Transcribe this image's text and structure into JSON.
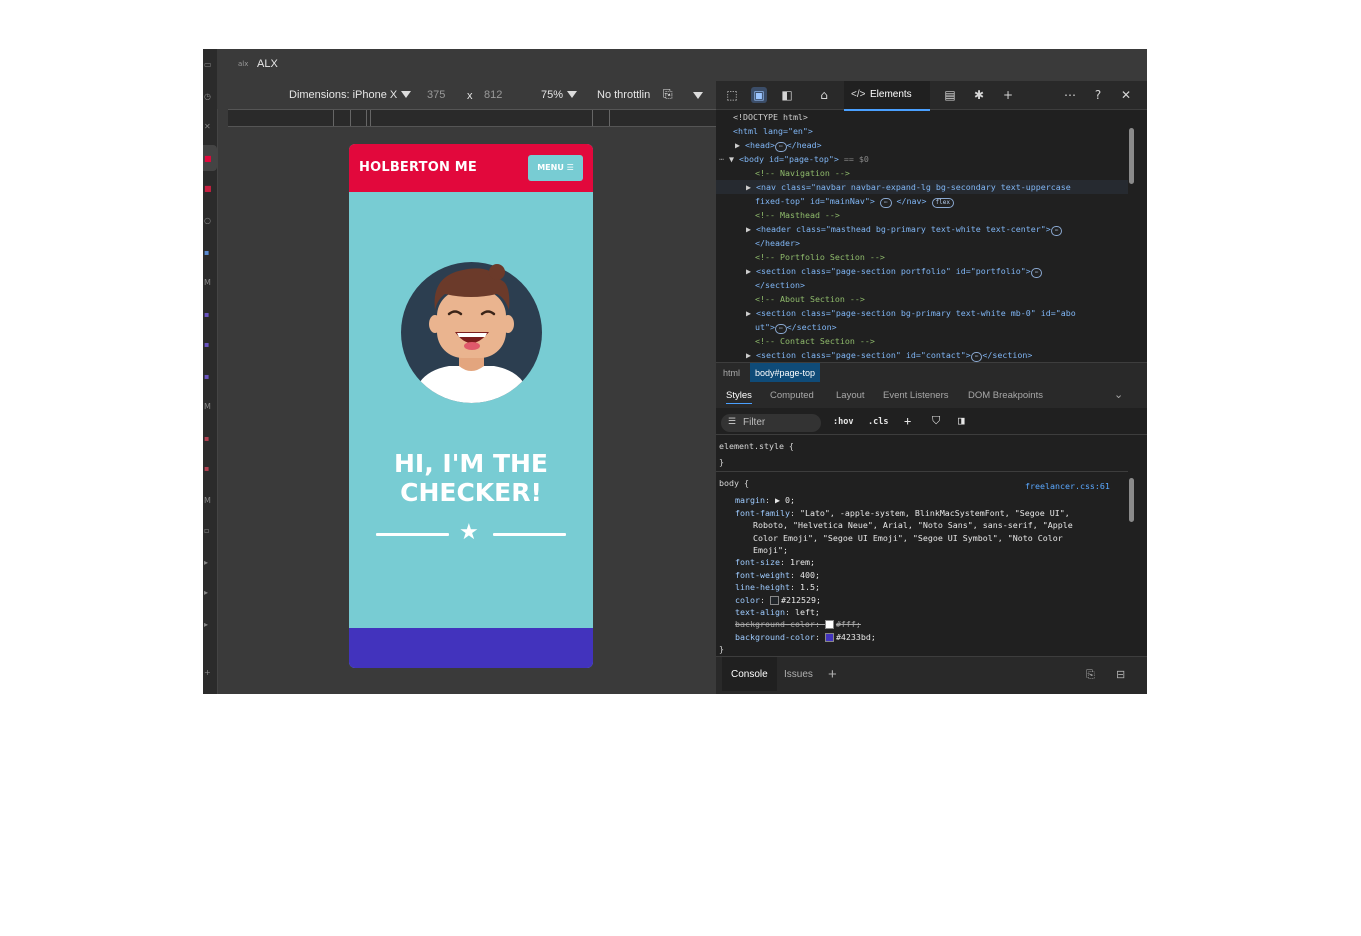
{
  "window": {
    "title": "ALX",
    "logo_text": "alx"
  },
  "device_toolbar": {
    "dimensions_label": "Dimensions: iPhone X",
    "width": "375",
    "times": "x",
    "height": "812",
    "zoom": "75%",
    "throttling": "No throttlin"
  },
  "site": {
    "brand": "HOLBERTON ME",
    "menu_label": "MENU",
    "hero_title_line1": "HI, I'M THE",
    "hero_title_line2": "CHECKER!",
    "colors": {
      "nav": "#e2083c",
      "hero": "#78ccd3",
      "footer": "#4233bd"
    }
  },
  "devtools": {
    "active_tab": "Elements",
    "dom": {
      "doctype": "<!DOCTYPE html>",
      "html_open": "<html lang=\"en\">",
      "head": "<head>",
      "head_close": "</head>",
      "body_prefix": "<body id=\"page-top\">",
      "body_suffix": "== $0",
      "cm_navigation": "<!-- Navigation -->",
      "nav_line1": "<nav class=\"navbar navbar-expand-lg bg-secondary text-uppercase",
      "nav_line2": "fixed-top\" id=\"mainNav\">",
      "nav_close": "</nav>",
      "flex_badge": "flex",
      "cm_masthead": "<!-- Masthead -->",
      "header_line1": "<header class=\"masthead bg-primary text-white text-center\">",
      "header_close": "</header>",
      "cm_portfolio": "<!-- Portfolio Section -->",
      "portfolio_line1": "<section class=\"page-section portfolio\" id=\"portfolio\">",
      "section_close": "</section>",
      "cm_about": "<!-- About Section -->",
      "about_line1": "<section class=\"page-section bg-primary text-white mb-0\" id=\"abo",
      "about_line2": "ut\">",
      "cm_contact": "<!-- Contact Section -->",
      "contact_line1": "<section class=\"page-section\" id=\"contact\">",
      "ellipsis": "⋯"
    },
    "breadcrumbs": [
      "html",
      "body#page-top"
    ],
    "styles_tabs": [
      "Styles",
      "Computed",
      "Layout",
      "Event Listeners",
      "DOM Breakpoints"
    ],
    "filter_placeholder": "Filter",
    "filter_buttons": [
      ":hov",
      ".cls"
    ],
    "styles": {
      "element_style_open": "element.style {",
      "element_style_close": "}",
      "body_selector": "body {",
      "source_link": "freelancer.css:61",
      "margin_name": "margin",
      "margin_value": "▶ 0;",
      "font_family_name": "font-family",
      "font_family_l1": "\"Lato\", -apple-system, BlinkMacSystemFont, \"Segoe UI\",",
      "font_family_l2": "Roboto, \"Helvetica Neue\", Arial, \"Noto Sans\", sans-serif, \"Apple",
      "font_family_l3": "Color Emoji\", \"Segoe UI Emoji\", \"Segoe UI Symbol\", \"Noto Color",
      "font_family_l4": "Emoji\";",
      "font_size_name": "font-size",
      "font_size_value": "1rem;",
      "font_weight_name": "font-weight",
      "font_weight_value": "400;",
      "line_height_name": "line-height",
      "line_height_value": "1.5;",
      "color_name": "color",
      "color_value": "#212529;",
      "text_align_name": "text-align",
      "text_align_value": "left;",
      "bg_old_name": "background-color",
      "bg_old_value": "#fff;",
      "bg_new_name": "background-color",
      "bg_new_value": "#4233bd;",
      "close": "}"
    },
    "swatches": {
      "color": "#212529",
      "bg_old": "#ffffff",
      "bg_new": "#4233bd"
    },
    "drawer_tabs": [
      "Console",
      "Issues"
    ]
  }
}
